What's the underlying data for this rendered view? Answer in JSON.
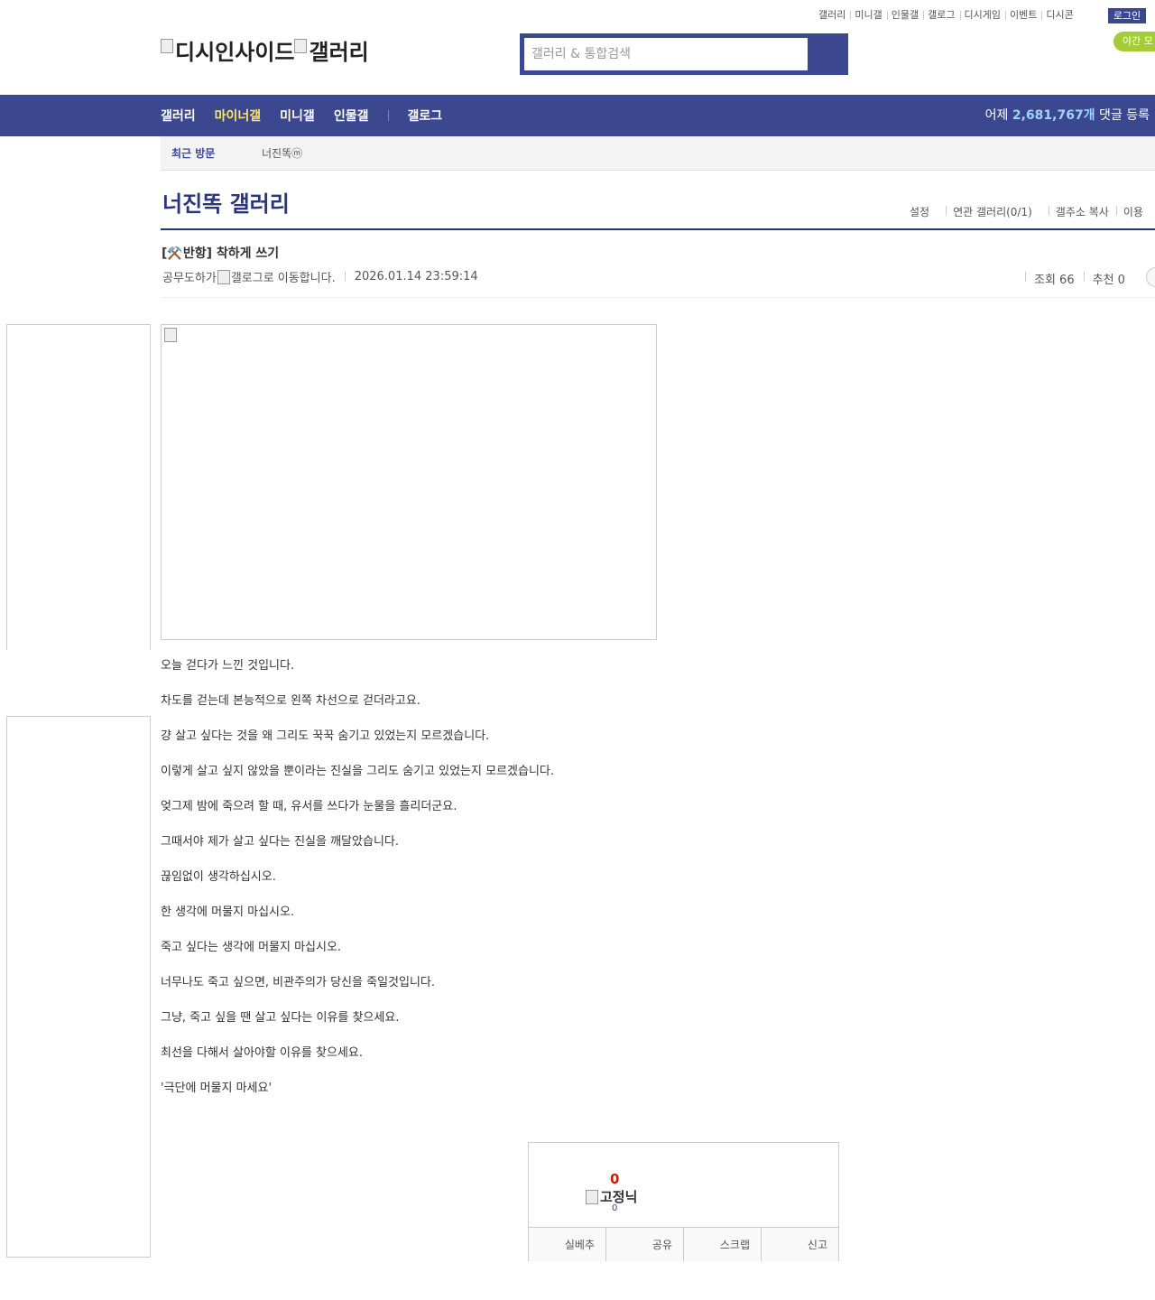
{
  "top_links": [
    "갤러리",
    "미니갤",
    "인물갤",
    "갤로그",
    "디시게임",
    "이벤트",
    "디시콘"
  ],
  "login_label": "로그인",
  "night_mode_label": "야간 모",
  "logo": {
    "part1": "디시인사이드",
    "part2": "갤러리"
  },
  "search": {
    "placeholder": "갤러리 & 통합검색"
  },
  "gnb": {
    "items": [
      "갤러리",
      "마이너갤",
      "미니갤",
      "인물갤"
    ],
    "gallog": "갤로그",
    "stat_prefix": "어제 ",
    "stat_number": "2,681,767개",
    "stat_suffix": " 댓글 등록"
  },
  "recent": {
    "label": "최근 방문",
    "item": "너진똑ⓜ"
  },
  "gallery": {
    "title": "너진똑 갤러리",
    "options": [
      "설정",
      "연관 갤러리(0/1)",
      "갤주소 복사",
      "이용"
    ]
  },
  "post": {
    "title": "[⚒️반항] 착하게 쓰기",
    "author": "공무도하가",
    "gallog_alt": "갤로그로 이동합니다.",
    "date": "2026.01.14 23:59:14",
    "views": "조회 66",
    "recommend": "추천 0",
    "lines": [
      "오늘 걷다가 느낀 것입니다.",
      "차도를 걷는데 본능적으로 왼쪽 차선으로 걷더라고요.",
      "걍 살고 싶다는 것을 왜 그리도 꾹꾹 숨기고 있었는지 모르겠습니다.",
      "이렇게 살고 싶지 않았을 뿐이라는 진실을 그리도 숨기고 있었는지 모르겠습니다.",
      "엊그제 밤에 죽으려 할 때, 유서를 쓰다가 눈물을 흘리더군요.",
      "그때서야 제가 살고 싶다는 진실을 깨달았습니다.",
      "끊임없이 생각하십시오.",
      "한 생각에 머물지 마십시오.",
      "죽고 싶다는 생각에 머물지 마십시오.",
      "너무나도 죽고 싶으면, 비관주의가 당신을 죽일것입니다.",
      "그냥, 죽고 싶을 땐 살고 싶다는 이유를 찾으세요.",
      "최선을 다해서 살아야할 이유를 찾으세요.",
      "'극단에 머물지 마세요'"
    ]
  },
  "rec_box": {
    "count": "0",
    "fixed_nick": "고정닉",
    "fixed_count": "0",
    "buttons": [
      "실베추",
      "공유",
      "스크랩",
      "신고"
    ]
  },
  "colors": {
    "brand": "#3b4890",
    "title": "#29367c",
    "highlight": "#ffe566",
    "night": "#a3cc36"
  }
}
